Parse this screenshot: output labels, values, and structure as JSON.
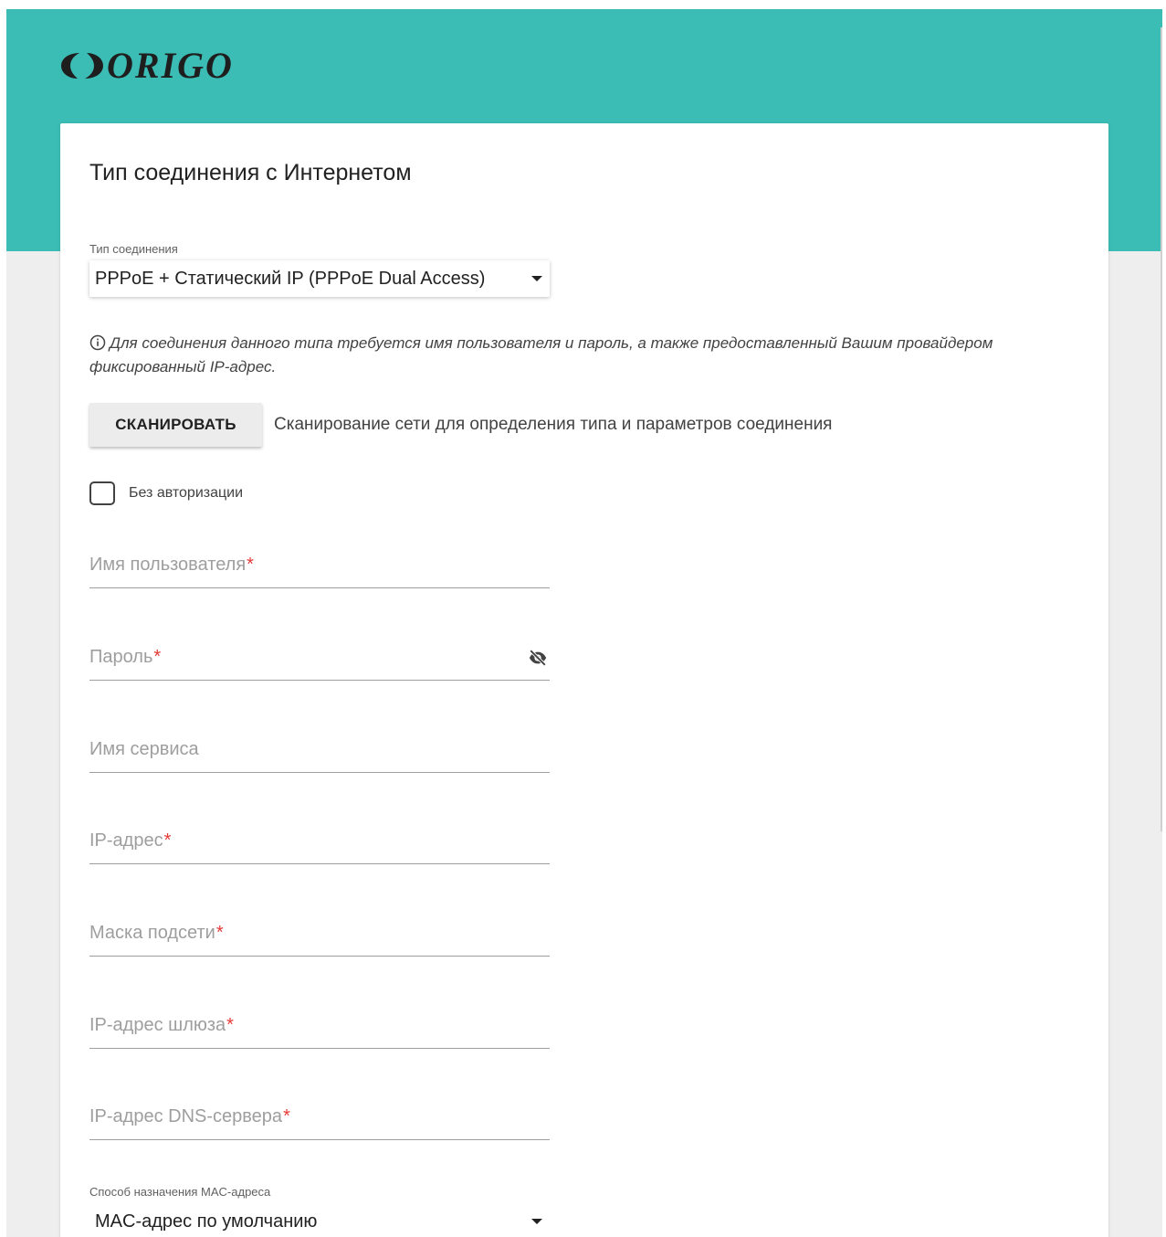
{
  "brand": {
    "name": "ORIGO",
    "accent": "#3bbcb5"
  },
  "page": {
    "title": "Тип соединения с Интернетом"
  },
  "connection_type": {
    "label": "Тип соединения",
    "value": "PPPoE + Статический IP (PPPoE Dual Access)"
  },
  "info": {
    "icon": "info-icon",
    "text": "Для соединения данного типа требуется имя пользователя и пароль, а также предоставленный Вашим провайдером фиксированный IP-адрес."
  },
  "scan": {
    "button_label": "СКАНИРОВАТЬ",
    "description": "Сканирование сети для определения типа и параметров соединения"
  },
  "no_auth": {
    "label": "Без авторизации",
    "checked": false
  },
  "fields": {
    "username": {
      "label": "Имя пользователя",
      "required_mark": "*"
    },
    "password": {
      "label": "Пароль",
      "required_mark": "*",
      "icon": "eye-off-icon"
    },
    "service_name": {
      "label": "Имя сервиса"
    },
    "ip_address": {
      "label": "IP-адрес",
      "required_mark": "*"
    },
    "subnet_mask": {
      "label": "Маска подсети",
      "required_mark": "*"
    },
    "gateway": {
      "label": "IP-адрес шлюза",
      "required_mark": "*"
    },
    "dns": {
      "label": "IP-адрес DNS-сервера",
      "required_mark": "*"
    }
  },
  "mac_assignment": {
    "label": "Способ назначения MAC-адреса",
    "value": "MAC-адрес по умолчанию"
  }
}
